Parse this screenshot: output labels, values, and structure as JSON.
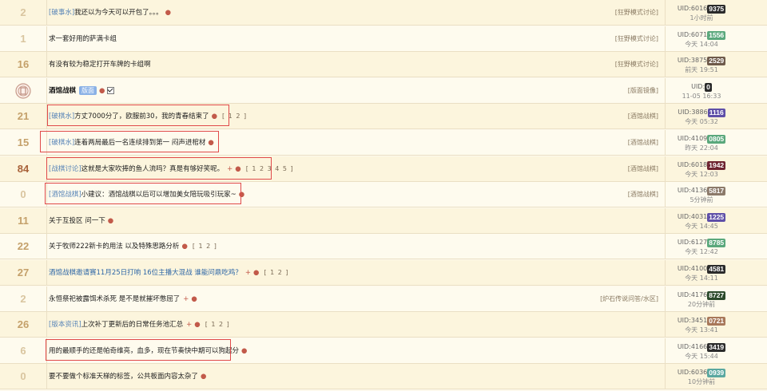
{
  "colors": {
    "accent": "#c25a4a",
    "link": "#2d66a6",
    "highlight": "#e04a4a",
    "count": "#d9b98a"
  },
  "threads": [
    {
      "count": "2",
      "count_color": "#d9c59f",
      "tag": "[破事水]",
      "title": "我还以为今天可以开包了。。。",
      "title_style": "normal",
      "dot": "●",
      "plus": "",
      "pages": "",
      "section": "[狂野模式讨论]",
      "uid_label": "UID:6016",
      "uid_num": "9375",
      "badge_color": "#2b2b2b",
      "time": "1小时前",
      "highlight": false
    },
    {
      "count": "1",
      "count_color": "#d9c59f",
      "tag": "",
      "title": "求一套好用的萨满卡组",
      "title_style": "normal",
      "dot": "",
      "plus": "",
      "pages": "",
      "section": "[狂野模式讨论]",
      "uid_label": "UID:6071",
      "uid_num": "1556",
      "badge_color": "#5aa87c",
      "time": "今天 14:04",
      "highlight": false
    },
    {
      "count": "16",
      "count_color": "#c4a06a",
      "tag": "",
      "title": "有没有较为稳定打开车牌的卡组啊",
      "title_style": "normal",
      "dot": "",
      "plus": "",
      "pages": "",
      "section": "[狂野模式讨论]",
      "uid_label": "UID:3875",
      "uid_num": "2529",
      "badge_color": "#6e5a4a",
      "time": "前天 19:51",
      "highlight": false
    },
    {
      "count": "",
      "count_color": "#c4a06a",
      "tag": "",
      "title": "酒馆战棋",
      "title_style": "bold",
      "dot": "●",
      "plus": "",
      "pages": "",
      "section": "[版面镜像]",
      "uid_label": "UID:",
      "uid_num": "0",
      "badge_color": "#2b2b2b",
      "time": "11-05 16:33",
      "highlight": false,
      "mod_tag": "版面",
      "logo": true,
      "check": true
    },
    {
      "count": "21",
      "count_color": "#c4a06a",
      "tag": "[破棋水]",
      "title": "方丈7000分了，欧服前30，我的青春结束了",
      "title_style": "normal",
      "dot": "●",
      "plus": "",
      "pages": "[ 1 2 ]",
      "section": "[酒馆战棋]",
      "uid_label": "UID:3886",
      "uid_num": "1116",
      "badge_color": "#5e4fa8",
      "time": "今天 05:32",
      "highlight": true
    },
    {
      "count": "15",
      "count_color": "#c4a06a",
      "tag": "[破棋水]",
      "title": "连着两局最后一名连续排到第一 闷声进棺材",
      "title_style": "normal",
      "dot": "●",
      "plus": "",
      "pages": "",
      "section": "[酒馆战棋]",
      "uid_label": "UID:4109",
      "uid_num": "0805",
      "badge_color": "#5aa87c",
      "time": "昨天 22:04",
      "highlight": true
    },
    {
      "count": "84",
      "count_color": "#a8623a",
      "tag": "[战棋讨论]",
      "title": "这就是大家吹捧的鱼人流吗？真是有够好笑呢。",
      "title_style": "normal",
      "dot": "●",
      "plus": "+",
      "pages": "[ 1 2 3 4 5 ]",
      "section": "[酒馆战棋]",
      "uid_label": "UID:6018",
      "uid_num": "1942",
      "badge_color": "#6e2430",
      "time": "今天 12:03",
      "highlight": true
    },
    {
      "count": "0",
      "count_color": "#d9c59f",
      "tag": "[酒馆战棋]",
      "title": "小建议：酒馆战棋以后可以增加美女陪玩吸引玩家~",
      "title_style": "normal",
      "dot": "●",
      "plus": "",
      "pages": "",
      "section": "[酒馆战棋]",
      "uid_label": "UID:4136",
      "uid_num": "5817",
      "badge_color": "#8c7a6a",
      "time": "5分钟前",
      "highlight": true
    },
    {
      "count": "11",
      "count_color": "#c4a06a",
      "tag": "",
      "title": "关于互投区 问一下",
      "title_style": "normal",
      "dot": "●",
      "plus": "",
      "pages": "",
      "section": "",
      "uid_label": "UID:4031",
      "uid_num": "1225",
      "badge_color": "#5e4fa8",
      "time": "今天 14:45",
      "highlight": false
    },
    {
      "count": "22",
      "count_color": "#c4a06a",
      "tag": "",
      "title": "关于牧师222新卡的用法 以及特殊思路分析",
      "title_style": "normal",
      "dot": "●",
      "plus": "",
      "pages": "[ 1 2 ]",
      "section": "",
      "uid_label": "UID:6127",
      "uid_num": "8785",
      "badge_color": "#5aa87c",
      "time": "今天 12:42",
      "highlight": false
    },
    {
      "count": "27",
      "count_color": "#c4a06a",
      "tag": "",
      "title": "酒馆战棋邀请赛11月25日打响 16位主播大混战 谁能问鼎吃鸡？",
      "title_style": "link",
      "dot": "●",
      "plus": "+",
      "pages": "[ 1 2 ]",
      "section": "",
      "uid_label": "UID:4100",
      "uid_num": "4581",
      "badge_color": "#2b2b2b",
      "time": "今天 14:11",
      "highlight": false
    },
    {
      "count": "2",
      "count_color": "#d9c59f",
      "tag": "",
      "title": "永恒祭祀被露饵术杀死 是不是就摧坏憋屈了",
      "title_style": "normal",
      "dot": "●",
      "plus": "+",
      "pages": "",
      "section": "[炉石传说问答/水区]",
      "uid_label": "UID:4176",
      "uid_num": "8727",
      "badge_color": "#2b4a2b",
      "time": "20分钟前",
      "highlight": false
    },
    {
      "count": "26",
      "count_color": "#c4a06a",
      "tag": "[版本资讯]",
      "title": "上次补丁更新后的日常任务池汇总",
      "title_style": "normal",
      "dot": "●",
      "plus": "+",
      "pages": "[ 1 2 ]",
      "section": "",
      "uid_label": "UID:3451",
      "uid_num": "0721",
      "badge_color": "#a8785a",
      "time": "今天 13:41",
      "highlight": false
    },
    {
      "count": "6",
      "count_color": "#d9c59f",
      "tag": "",
      "title": "用的最顺手的还是帕奇维亮，血多，现在节奏快中期可以狗起分",
      "title_style": "normal",
      "dot": "●",
      "plus": "",
      "pages": "",
      "section": "",
      "uid_label": "UID:4166",
      "uid_num": "3419",
      "badge_color": "#2b2b2b",
      "time": "今天 15:44",
      "highlight": true
    },
    {
      "count": "0",
      "count_color": "#d9c59f",
      "tag": "",
      "title": "要不要做个标准天梯的标签，公共板面内容太杂了",
      "title_style": "normal",
      "dot": "●",
      "plus": "",
      "pages": "",
      "section": "",
      "uid_label": "UID:6036",
      "uid_num": "0939",
      "badge_color": "#5aa8a0",
      "time": "10分钟前",
      "highlight": false
    }
  ]
}
